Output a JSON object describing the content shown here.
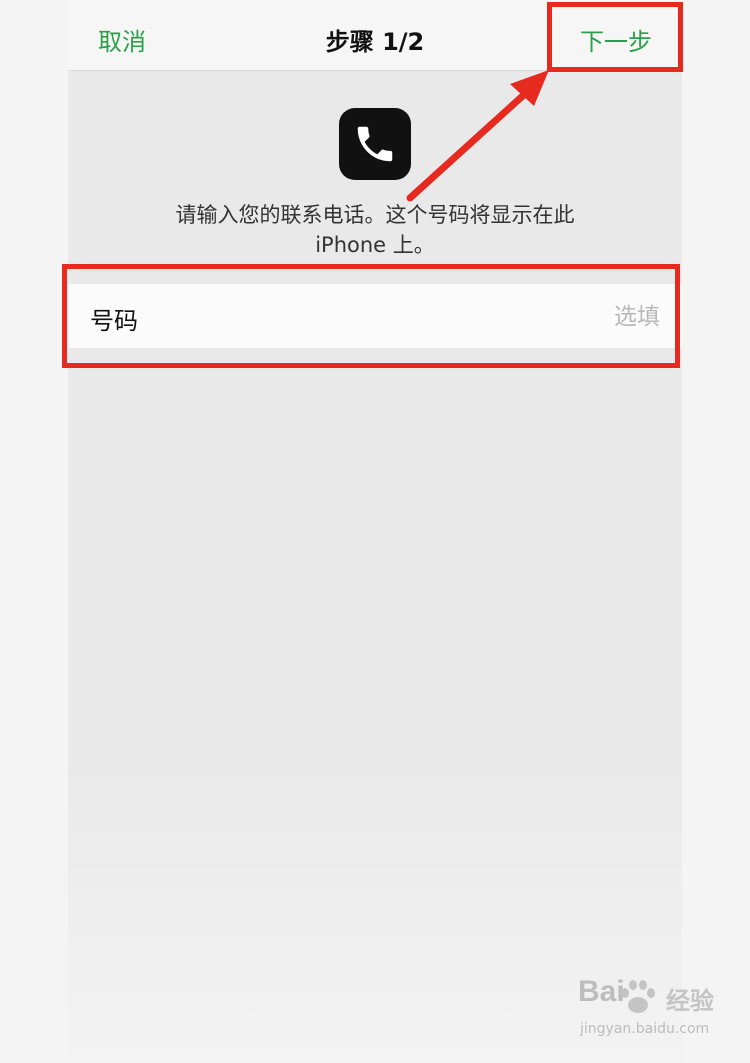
{
  "nav": {
    "cancel_label": "取消",
    "title": "步骤 1/2",
    "next_label": "下一步"
  },
  "app_icon": "phone-icon",
  "description": {
    "line1": "请输入您的联系电话。这个号码将显示在此",
    "line2": "iPhone 上。"
  },
  "phone_field": {
    "label": "号码",
    "placeholder": "选填",
    "value": ""
  },
  "watermark": {
    "brand_left": "Bai",
    "brand_right": "经验",
    "url": "jingyan.baidu.com"
  },
  "colors": {
    "accent_green": "#2aa04a",
    "annotation_red": "#e62a20",
    "icon_bg": "#111111"
  }
}
